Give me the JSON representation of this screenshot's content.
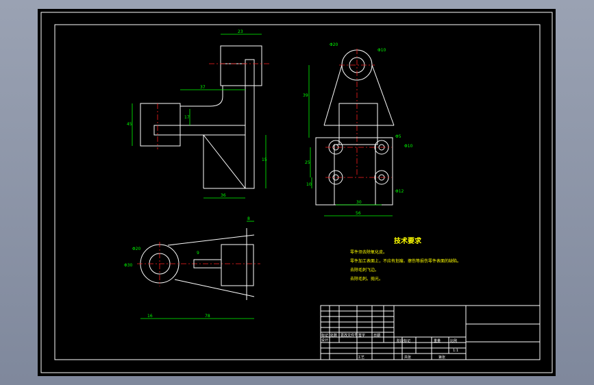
{
  "dimensions": {
    "top_view": {
      "d23": "23",
      "d37": "37",
      "d17": "17",
      "d45": "45",
      "d15": "15",
      "d36": "36"
    },
    "right_view": {
      "d39": "39",
      "d30": "30",
      "d10": "10",
      "d56": "56",
      "d25": "25",
      "phi10": "Φ10",
      "phi10_2": "Φ10",
      "phi10_3": "Φ10",
      "phi12": "Φ12",
      "phi10_4": "Φ10",
      "phi20": "Φ20",
      "phi5": "Φ5"
    },
    "front_view": {
      "d16": "16",
      "d78": "78",
      "d8": "8",
      "d9": "9",
      "phi20": "Φ20",
      "phi30": "Φ30"
    }
  },
  "notes": {
    "title": "技术要求",
    "lines": [
      "零件须去除氧化皮。",
      "零件加工表面上，不应有划痕、擦伤等损伤零件表面的缺陷。",
      "去除毛刺飞边。",
      "去除毛刺。抛光。"
    ]
  },
  "title_block": {
    "labels": [
      "标记",
      "处数",
      "更改文件号",
      "签字",
      "日期",
      "设计",
      "审核",
      "工艺",
      "阶段标记",
      "重量",
      "比例",
      "共张",
      "第张"
    ],
    "scale": "1:1"
  }
}
